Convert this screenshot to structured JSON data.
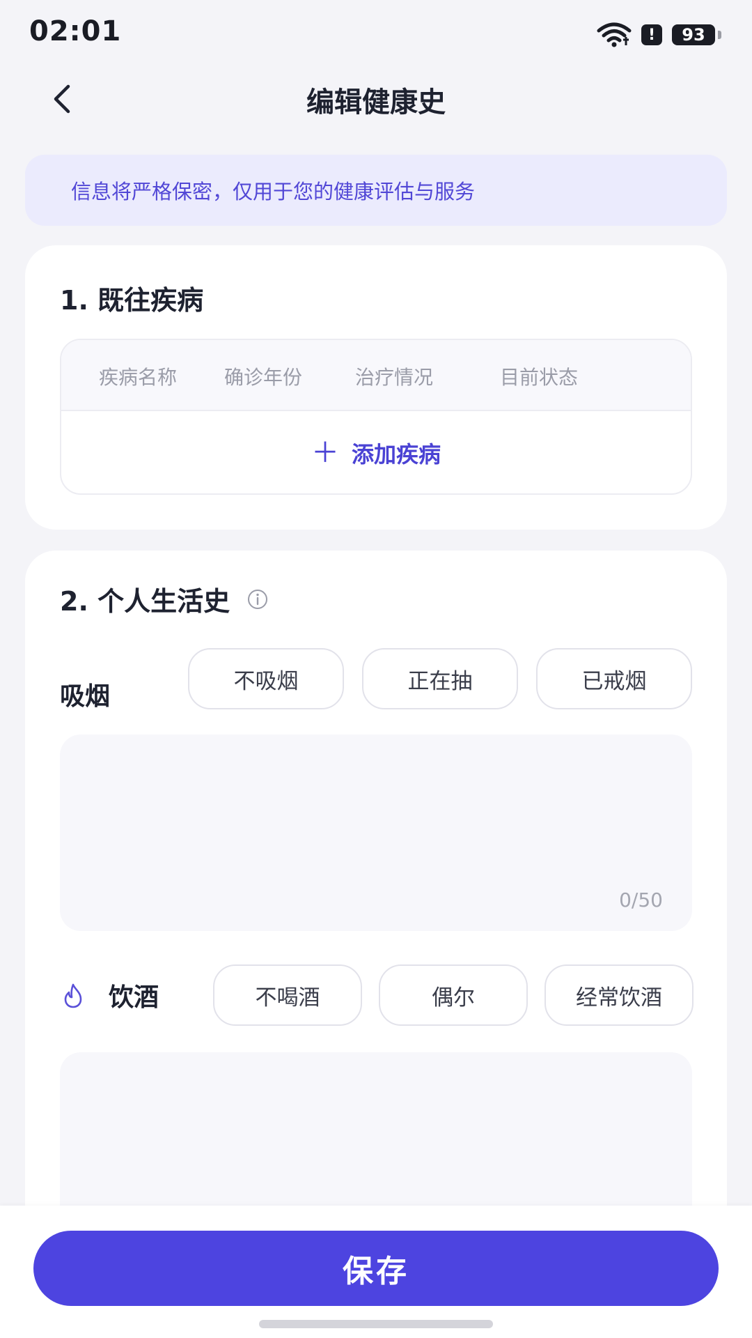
{
  "status_bar": {
    "time": "02:01",
    "battery": "93",
    "alert_symbol": "!",
    "icons": [
      "wifi-icon",
      "alert-icon",
      "battery-icon"
    ]
  },
  "header": {
    "title": "编辑健康史",
    "back_icon": "chevron-left-icon"
  },
  "notice": {
    "text": "信息将严格保密，仅用于您的健康评估与服务"
  },
  "past_diseases": {
    "title": "1. 既往疾病",
    "columns": [
      "疾病名称",
      "确诊年份",
      "治疗情况",
      "目前状态"
    ],
    "add_label": "添加疾病",
    "add_icon": "plus-icon"
  },
  "lifestyle": {
    "title": "2. 个人生活史",
    "info_icon": "info-icon",
    "smoking": {
      "label": "吸烟",
      "options": [
        "不吸烟",
        "正在抽",
        "已戒烟"
      ],
      "note_value": "",
      "counter": "0/50"
    },
    "drinking": {
      "label": "饮酒",
      "icon": "flame-icon",
      "options": [
        "不喝酒",
        "偶尔",
        "经常饮酒"
      ],
      "note_value": ""
    }
  },
  "footer": {
    "save_label": "保存"
  },
  "colors": {
    "accent": "#4D44E0",
    "notice_bg": "#EBEBFD",
    "notice_text": "#5147D6",
    "page_bg": "#F4F4F8"
  }
}
